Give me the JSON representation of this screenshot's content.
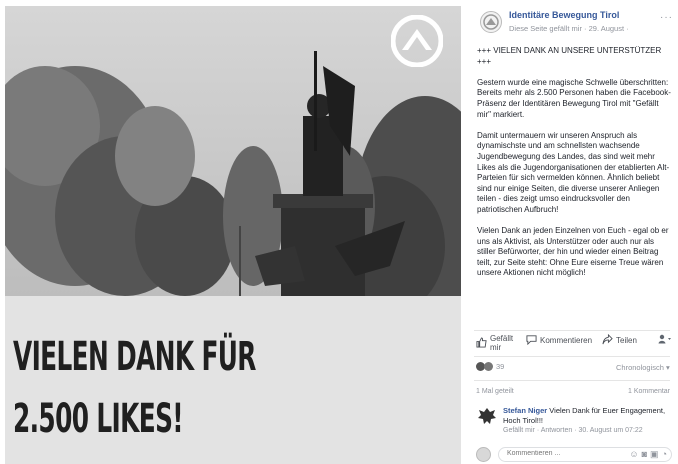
{
  "photo": {
    "caption_line1": "VIELEN DANK FÜR",
    "caption_line2": "2.500 LIKES!"
  },
  "sidebar": {
    "page_name": "Identitäre Bewegung Tirol",
    "subline": "Diese Seite gefällt mir · 29. August ·",
    "more": "···",
    "post_paragraphs": [
      "+++ VIELEN DANK AN UNSERE UNTERSTÜTZER +++",
      "Gestern wurde eine magische Schwelle überschritten: Bereits mehr als 2.500 Personen haben die Facebook-Präsenz der Identitären Bewegung Tirol mit \"Gefällt mir\" markiert.",
      "Damit untermauern wir unseren Anspruch als dynamischste und am schnellsten wachsende Jugendbewegung des Landes, das sind weit mehr Likes als die Jugendorganisationen der etablierten Alt-Parteien für sich vermelden können. Ähnlich beliebt sind nur einige Seiten, die diverse unserer Anliegen teilen - dies zeigt umso eindrucksvoller den patriotischen Aufbruch!",
      "Vielen Dank an jeden Einzelnen von Euch - egal ob er uns als Aktivist, als Unterstützer oder auch nur als stiller Befürworter, der hin und wieder einen Beitrag teilt, zur Seite steht: Ohne Eure eiserne Treue wären unsere Aktionen nicht möglich!"
    ],
    "actions": {
      "like": "Gefällt mir",
      "comment": "Kommentieren",
      "share": "Teilen"
    },
    "reaction_count": "39",
    "sort_label": "Chronologisch",
    "shares": "1 Mal geteilt",
    "comments_count": "1 Kommentar",
    "comment": {
      "author": "Stefan Niger",
      "text": "Vielen Dank für Euer Engagement, Hoch Tirol!!!",
      "meta": "Gefällt mir · Antworten · 30. August um 07:22"
    },
    "input_placeholder": "Kommentieren ..."
  },
  "colors": {
    "link": "#365899",
    "muted": "#90949c",
    "text": "#1d2129"
  }
}
